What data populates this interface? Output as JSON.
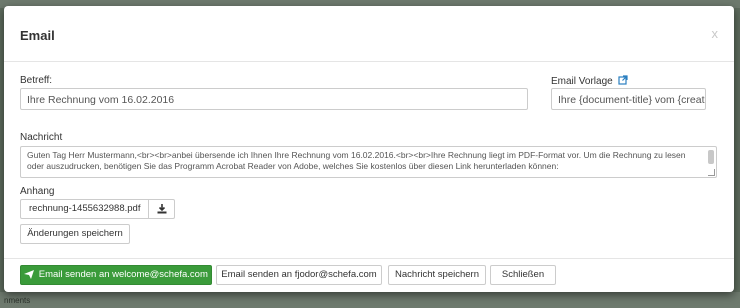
{
  "modal": {
    "title": "Email",
    "close": "x"
  },
  "form": {
    "subject_label": "Betreff:",
    "subject_value": "Ihre Rechnung vom 16.02.2016",
    "template_label": "Email Vorlage",
    "template_value": "Ihre {document-title} vom {created",
    "message_label": "Nachricht",
    "message_value": "Guten Tag Herr Mustermann,<br><br>anbei übersende ich Ihnen Ihre Rechnung vom 16.02.2016.<br><br>Ihre Rechnung liegt im PDF-Format vor. Um die Rechnung zu lesen oder auszudrucken, benötigen Sie das Programm Acrobat Reader von Adobe, welches Sie kostenlos über diesen Link herunterladen können:",
    "attachment_label": "Anhang",
    "attachment_file": "rechnung-1455632988.pdf",
    "save_changes": "Änderungen speichern"
  },
  "footer": {
    "send_primary": "Email senden an welcome@schefa.com",
    "send_secondary": "Email senden an fjodor@schefa.com",
    "save_message": "Nachricht speichern",
    "close": "Schließen"
  },
  "background": {
    "bottom_text": "nments"
  },
  "colors": {
    "primary": "#3a9b3a",
    "link_icon": "#2a7fc0"
  }
}
